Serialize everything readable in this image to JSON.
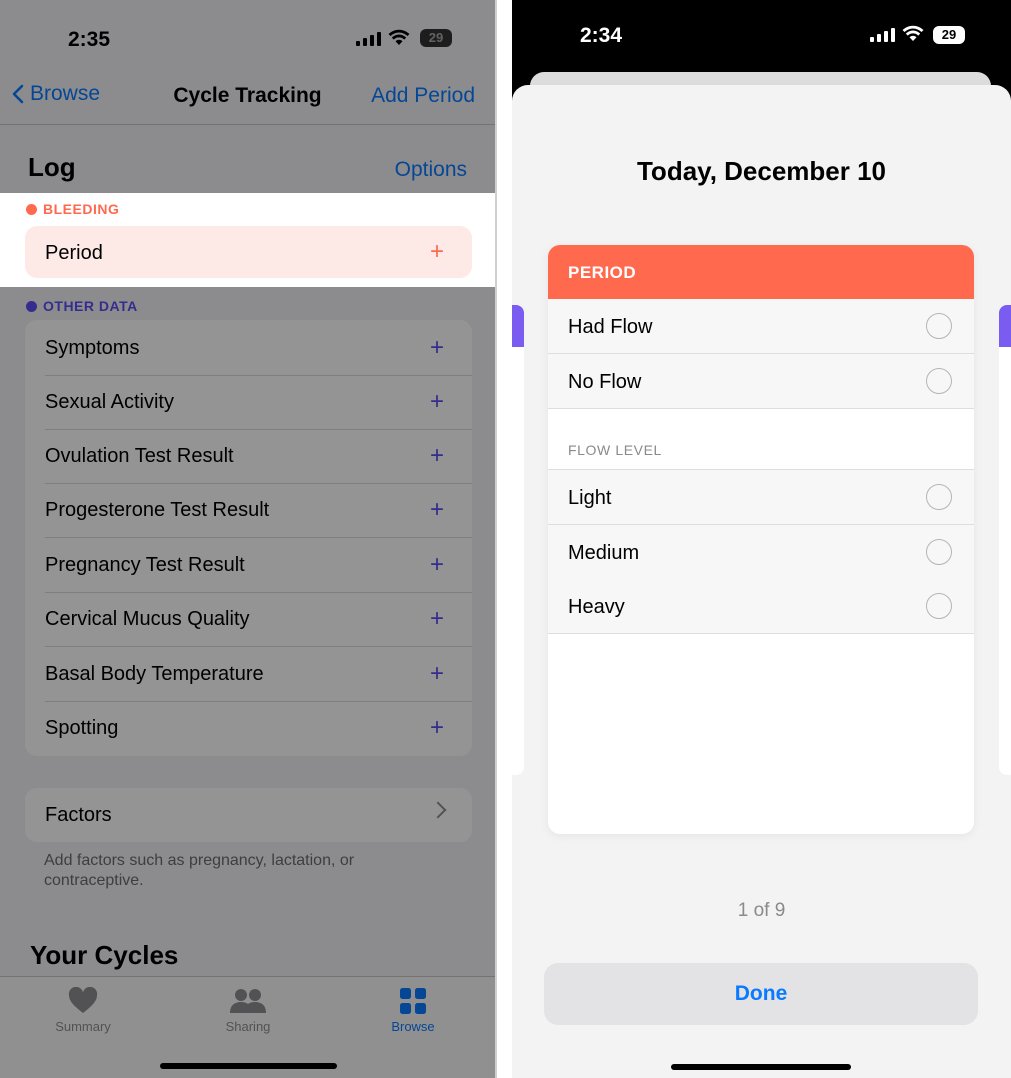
{
  "left": {
    "status": {
      "time": "2:35",
      "battery": "29"
    },
    "nav": {
      "back_label": "Browse",
      "title": "Cycle Tracking",
      "action_label": "Add Period"
    },
    "log": {
      "title": "Log",
      "options_label": "Options"
    },
    "bleeding": {
      "section_label": "BLEEDING",
      "dot_color": "#ff6a4f",
      "item_label": "Period",
      "plus": "+"
    },
    "other_data": {
      "section_label": "OTHER DATA",
      "dot_color": "#5b4ff3",
      "items": [
        {
          "label": "Symptoms",
          "plus": "+"
        },
        {
          "label": "Sexual Activity",
          "plus": "+"
        },
        {
          "label": "Ovulation Test Result",
          "plus": "+"
        },
        {
          "label": "Progesterone Test Result",
          "plus": "+"
        },
        {
          "label": "Pregnancy Test Result",
          "plus": "+"
        },
        {
          "label": "Cervical Mucus Quality",
          "plus": "+"
        },
        {
          "label": "Basal Body Temperature",
          "plus": "+"
        },
        {
          "label": "Spotting",
          "plus": "+"
        }
      ]
    },
    "factors": {
      "label": "Factors",
      "note": "Add factors such as pregnancy, lactation, or contraceptive."
    },
    "cycles_title": "Your Cycles",
    "tabbar": {
      "tabs": [
        {
          "label": "Summary",
          "icon": "heart-icon"
        },
        {
          "label": "Sharing",
          "icon": "people-icon"
        },
        {
          "label": "Browse",
          "icon": "grid-icon"
        }
      ],
      "active_color": "#0a7aff"
    }
  },
  "right": {
    "status": {
      "time": "2:34",
      "battery": "29"
    },
    "date_title": "Today, December 10",
    "card": {
      "header": "PERIOD",
      "header_color": "#ff6a4f",
      "flow_options": [
        {
          "label": "Had Flow"
        },
        {
          "label": "No Flow"
        }
      ],
      "flow_level_label": "FLOW LEVEL",
      "level_options": [
        {
          "label": "Light"
        },
        {
          "label": "Medium"
        },
        {
          "label": "Heavy"
        }
      ]
    },
    "page_indicator": "1 of 9",
    "done_label": "Done"
  }
}
